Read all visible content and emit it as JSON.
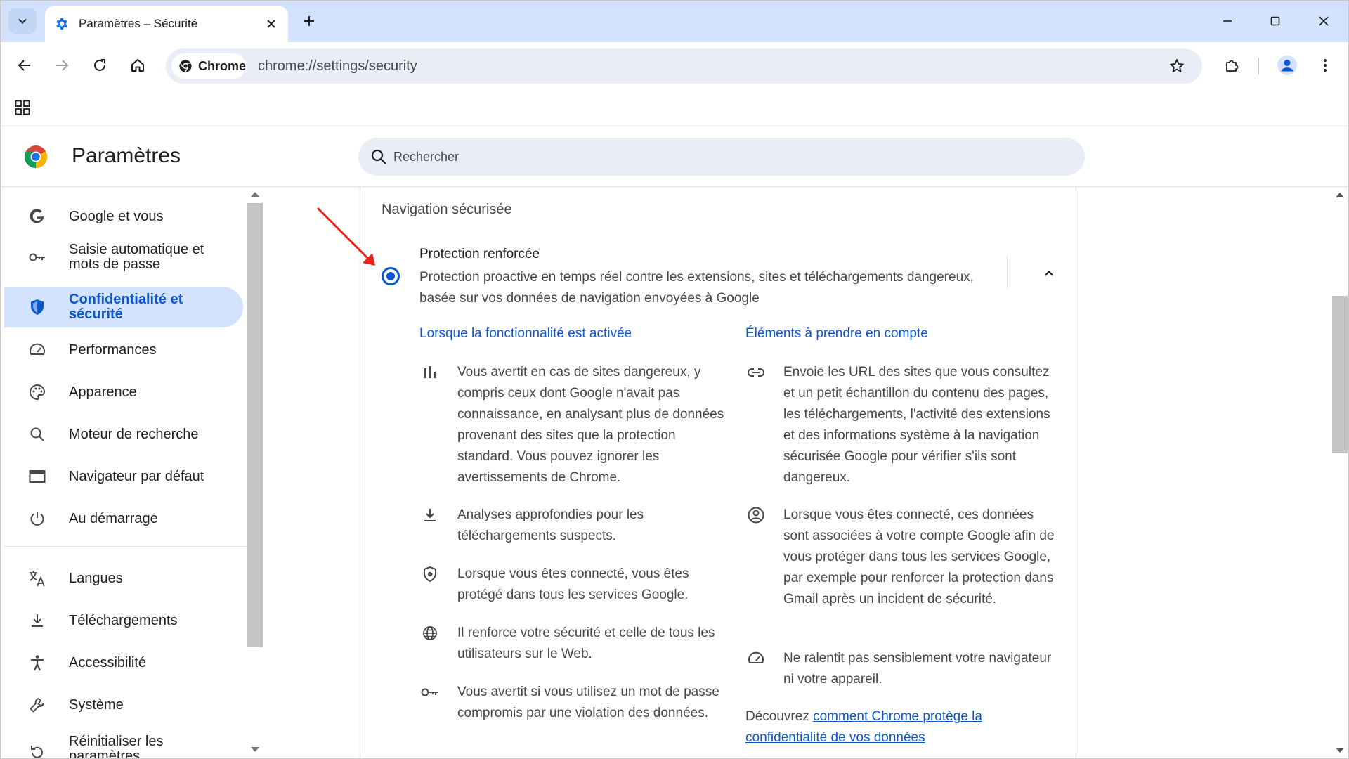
{
  "browser": {
    "tab_title": "Paramètres – Sécurité",
    "chip_label": "Chrome",
    "url": "chrome://settings/security"
  },
  "header": {
    "title": "Paramètres",
    "search_placeholder": "Rechercher"
  },
  "sidebar": {
    "items": [
      {
        "label": "Google et vous",
        "icon": "google-g-icon"
      },
      {
        "label": "Saisie automatique et mots de passe",
        "icon": "key-icon"
      },
      {
        "label": "Confidentialité et sécurité",
        "icon": "shield-icon",
        "active": true
      },
      {
        "label": "Performances",
        "icon": "speedometer-icon"
      },
      {
        "label": "Apparence",
        "icon": "palette-icon"
      },
      {
        "label": "Moteur de recherche",
        "icon": "search-icon"
      },
      {
        "label": "Navigateur par défaut",
        "icon": "browser-window-icon"
      },
      {
        "label": "Au démarrage",
        "icon": "power-icon"
      },
      {
        "label": "Langues",
        "icon": "translate-icon"
      },
      {
        "label": "Téléchargements",
        "icon": "download-icon"
      },
      {
        "label": "Accessibilité",
        "icon": "accessibility-icon"
      },
      {
        "label": "Système",
        "icon": "wrench-icon"
      },
      {
        "label": "Réinitialiser les paramètres",
        "icon": "reset-icon"
      }
    ]
  },
  "main": {
    "section_title": "Navigation sécurisée",
    "option": {
      "title": "Protection renforcée",
      "description": "Protection proactive en temps réel contre les extensions, sites et téléchargements dangereux, basée sur vos données de navigation envoyées à Google",
      "selected": true
    },
    "left_column": {
      "heading": "Lorsque la fonctionnalité est activée",
      "items": [
        {
          "icon": "bar-chart-icon",
          "text": "Vous avertit en cas de sites dangereux, y compris ceux dont Google n'avait pas connaissance, en analysant plus de données provenant des sites que la protection standard. Vous pouvez ignorer les avertissements de Chrome."
        },
        {
          "icon": "download-icon",
          "text": "Analyses approfondies pour les téléchargements suspects."
        },
        {
          "icon": "google-shield-icon",
          "text": "Lorsque vous êtes connecté, vous êtes protégé dans tous les services Google."
        },
        {
          "icon": "globe-icon",
          "text": "Il renforce votre sécurité et celle de tous les utilisateurs sur le Web."
        },
        {
          "icon": "key-icon",
          "text": "Vous avertit si vous utilisez un mot de passe compromis par une violation des données."
        }
      ]
    },
    "right_column": {
      "heading": "Éléments à prendre en compte",
      "items": [
        {
          "icon": "link-icon",
          "text": "Envoie les URL des sites que vous consultez et un petit échantillon du contenu des pages, les téléchargements, l'activité des extensions et des informations système à la navigation sécurisée Google pour vérifier s'ils sont dangereux."
        },
        {
          "icon": "account-circle-icon",
          "text": "Lorsque vous êtes connecté, ces données sont associées à votre compte Google afin de vous protéger dans tous les services Google, par exemple pour renforcer la protection dans Gmail après un incident de sécurité."
        },
        {
          "icon": "speedometer-icon",
          "text": "Ne ralentit pas sensiblement votre navigateur ni votre appareil."
        }
      ],
      "footer_prefix": "Découvrez ",
      "footer_link": "comment Chrome protège la confidentialité de vos données"
    }
  },
  "colors": {
    "accent": "#0b57d0",
    "tabstrip": "#d3e3fd",
    "annotation_arrow": "#e8231f"
  }
}
